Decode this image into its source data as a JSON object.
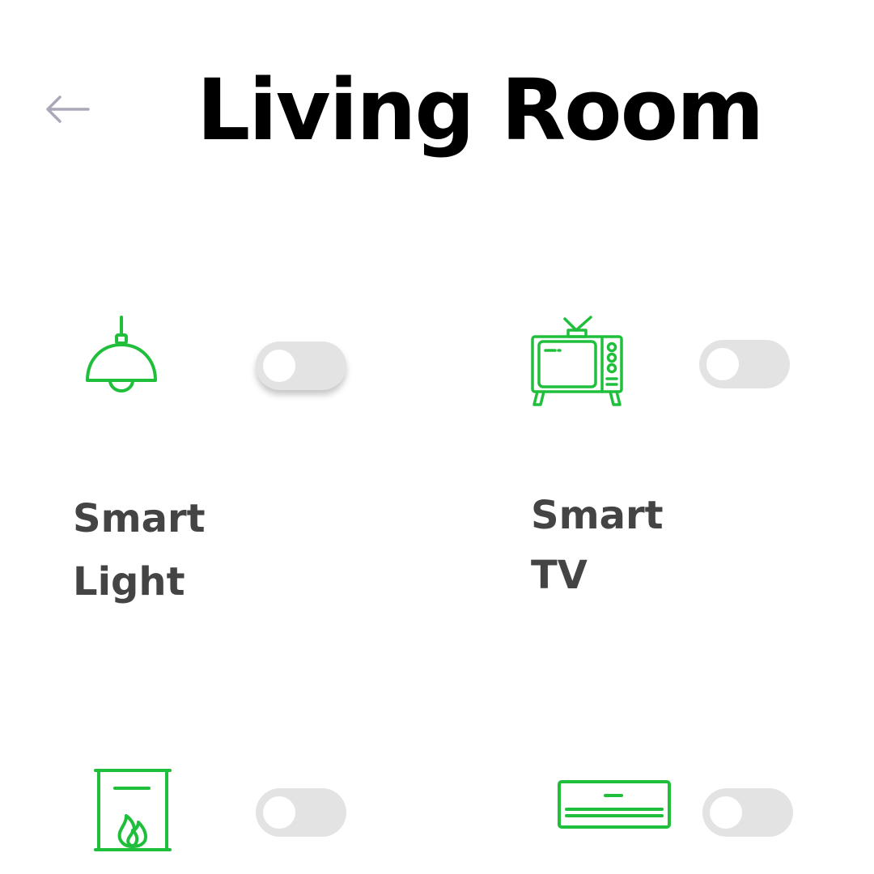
{
  "header": {
    "title": "Living Room",
    "back_icon": "arrow-left-icon"
  },
  "colors": {
    "accent": "#1fbf3c",
    "label": "#444444",
    "toggle_track": "#e3e3e3",
    "back_arrow": "#a9a9b8"
  },
  "devices": [
    {
      "line1": "Smart",
      "line2": "Light",
      "icon": "pendant-lamp-icon",
      "on": false
    },
    {
      "line1": "Smart",
      "line2": "TV",
      "icon": "television-icon",
      "on": false
    },
    {
      "icon": "fireplace-icon",
      "on": false
    },
    {
      "icon": "air-conditioner-icon",
      "on": false
    }
  ]
}
